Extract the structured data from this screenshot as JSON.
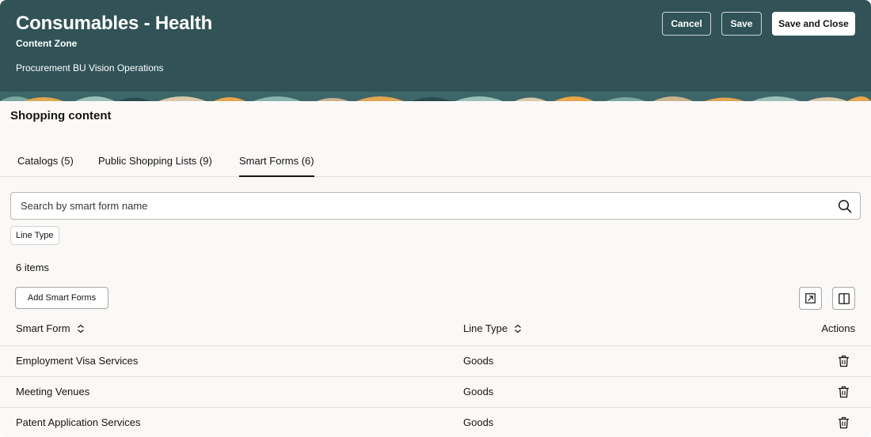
{
  "header": {
    "title": "Consumables - Health",
    "subtitle": "Content Zone",
    "bu_label": "Procurement BU",
    "bu_value": "Vision Operations",
    "buttons": {
      "cancel": "Cancel",
      "save": "Save",
      "save_close": "Save and Close"
    },
    "bg_color": "#315357"
  },
  "section_title": "Shopping content",
  "tabs": [
    {
      "label": "Catalogs (5)",
      "active": false
    },
    {
      "label": "Public Shopping Lists (9)",
      "active": false
    },
    {
      "label": "Smart Forms (6)",
      "active": true
    }
  ],
  "search": {
    "placeholder": "Search by smart form name",
    "value": ""
  },
  "filter_chip": "Line Type",
  "item_count": "6 items",
  "toolbar": {
    "add_label": "Add Smart Forms",
    "export_icon": "export-icon",
    "columns_icon": "columns-icon"
  },
  "table": {
    "columns": [
      "Smart Form",
      "Line Type",
      "Actions"
    ],
    "rows": [
      {
        "smart_form": "Employment Visa Services",
        "line_type": "Goods"
      },
      {
        "smart_form": "Meeting Venues",
        "line_type": "Goods"
      },
      {
        "smart_form": "Patent Application Services",
        "line_type": "Goods"
      }
    ]
  }
}
